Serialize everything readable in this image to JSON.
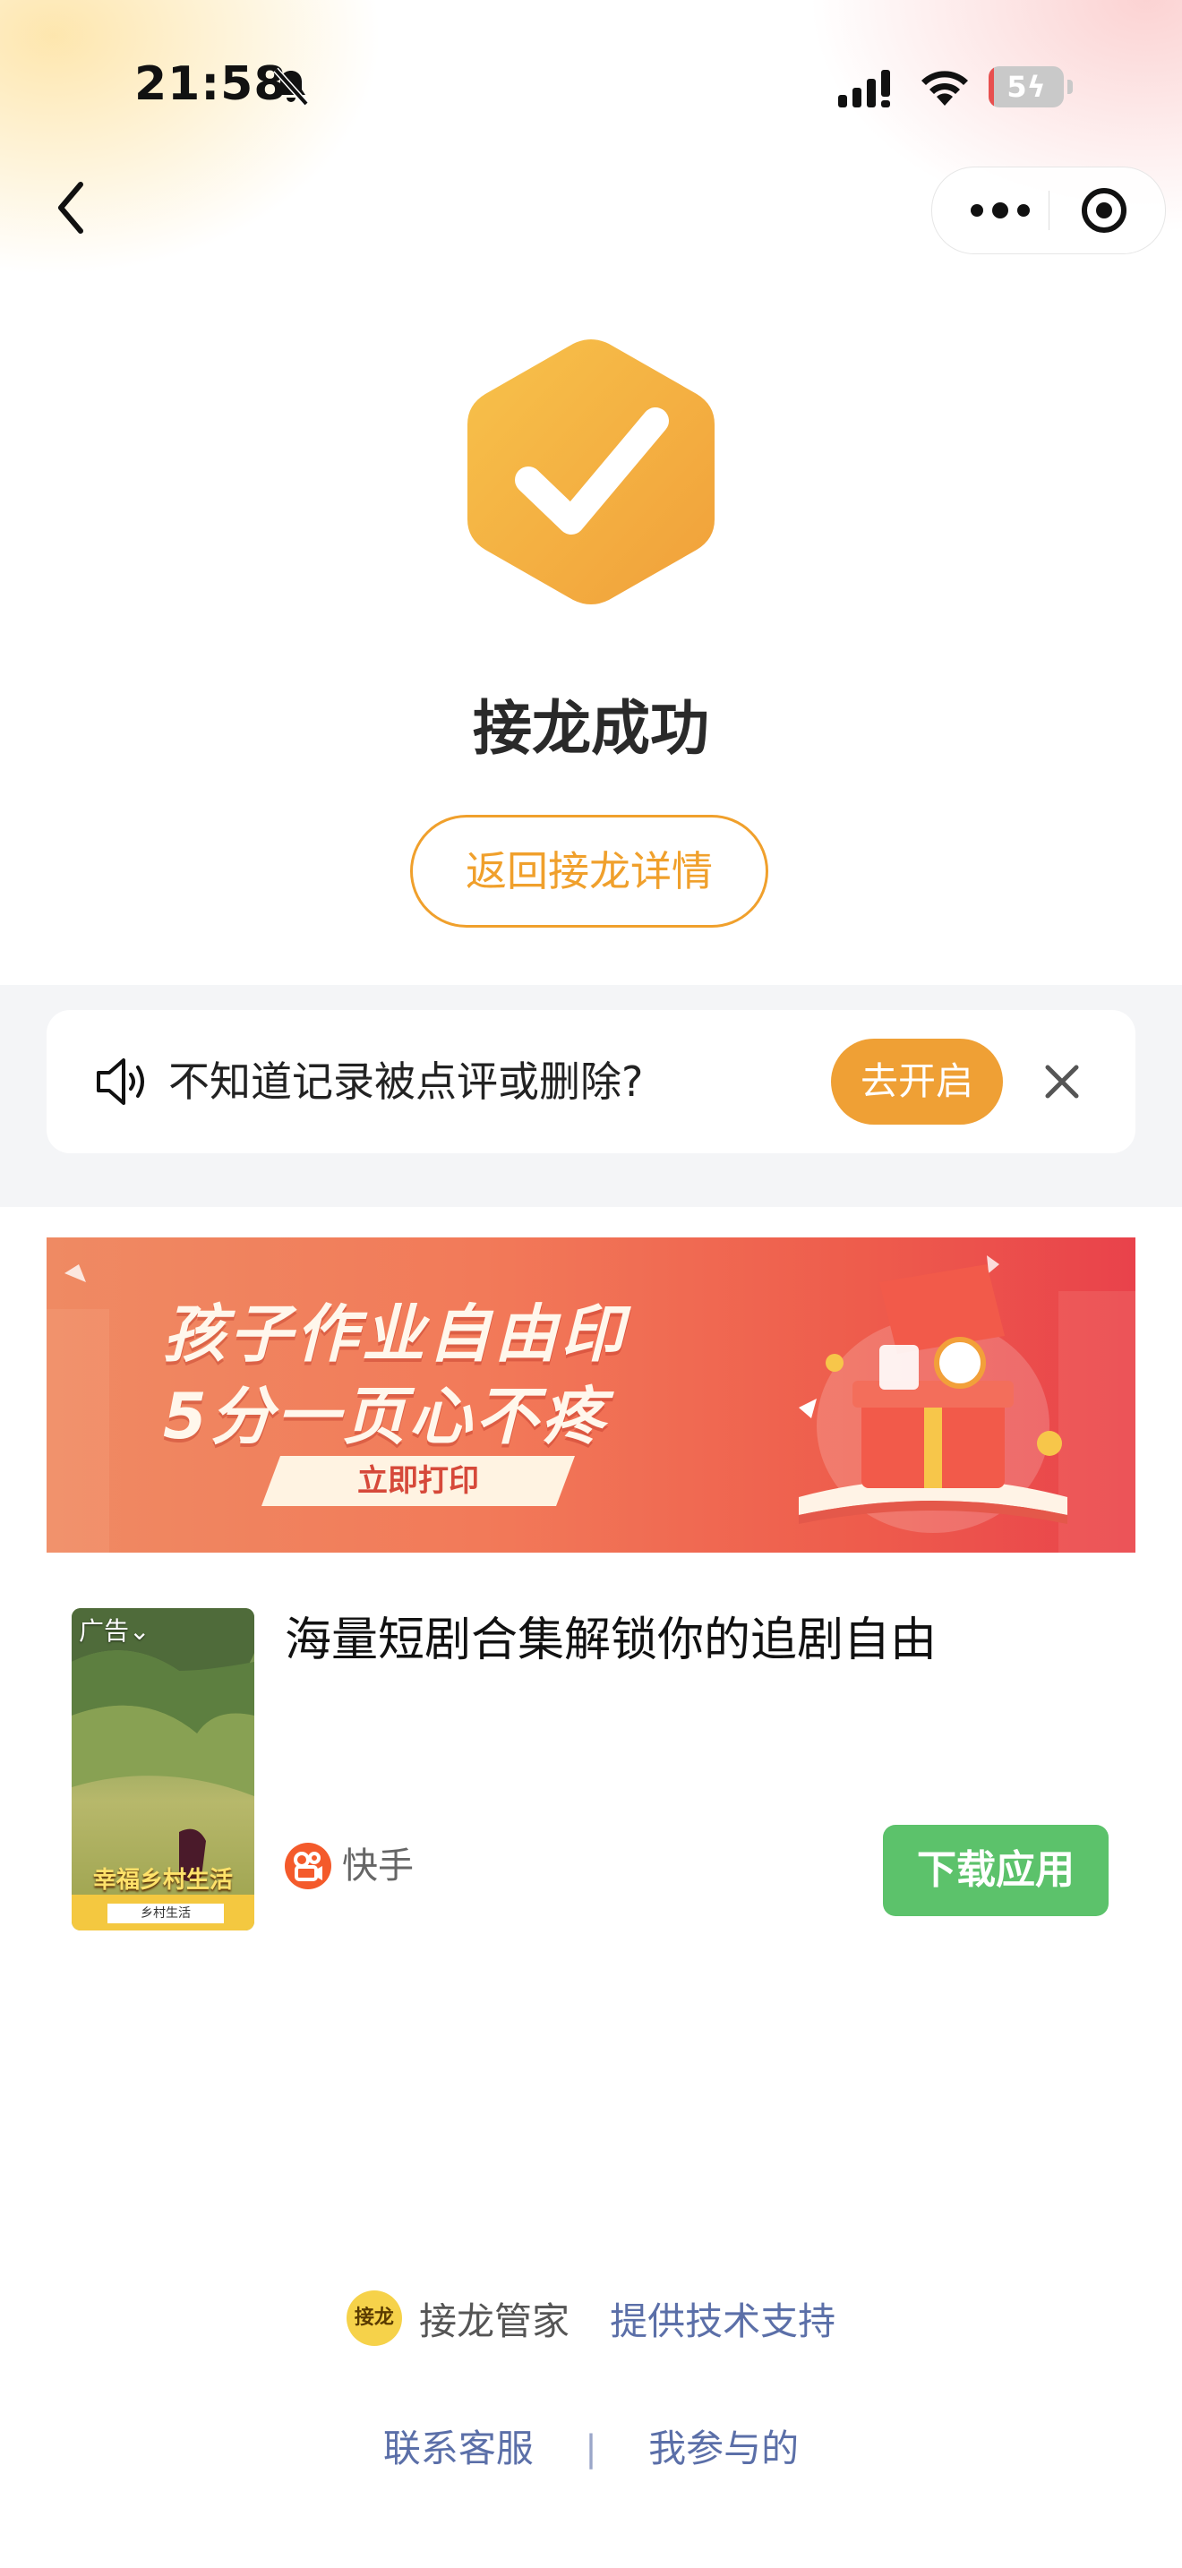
{
  "status_bar": {
    "time": "21:58",
    "battery_text": "5",
    "battery_level": 0.05,
    "icons": [
      "bell-slash-icon",
      "cellular-signal-icon",
      "wifi-icon",
      "battery-charging-icon"
    ]
  },
  "nav": {
    "back_icon": "chevron-left-icon",
    "capsule_icons": [
      "more-dots-icon",
      "close-circle-icon"
    ]
  },
  "success": {
    "icon": "hexagon-check-icon",
    "title": "接龙成功",
    "return_button": "返回接龙详情"
  },
  "notice": {
    "icon": "speaker-icon",
    "text": "不知道记录被点评或删除?",
    "enable_button": "去开启",
    "close_icon": "close-x-icon"
  },
  "banner_ad": {
    "line1": "孩子作业自由印",
    "line2": "5分一页心不疼",
    "cta": "立即打印"
  },
  "native_ad": {
    "badge": "广告⌄",
    "thumb_caption": "幸福乡村生活",
    "thumb_subcaption": "乡村生活",
    "title": "海量短剧合集解锁你的追剧自由",
    "advertiser": "快手",
    "download_button": "下载应用"
  },
  "footer": {
    "logo_text": "接龙",
    "app_name": "接龙管家",
    "support_text": "提供技术支持",
    "links": [
      "联系客服",
      "我参与的"
    ],
    "separator": "|"
  },
  "colors": {
    "accent_orange": "#f0a02c",
    "download_green": "#5cc26b",
    "link_blue": "#5b6fa8"
  }
}
